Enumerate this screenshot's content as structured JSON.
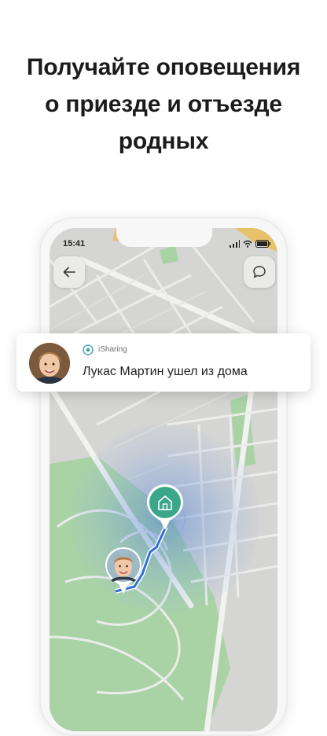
{
  "headline": {
    "line1": "Получайте оповещения",
    "line2": "о приезде и отъезде",
    "line3": "родных"
  },
  "status_bar": {
    "time": "15:41"
  },
  "notification": {
    "app_name": "iSharing",
    "message": "Лукас Мартин ушел из дома"
  },
  "icons": {
    "back": "arrow-left-icon",
    "chat": "chat-bubble-icon",
    "home": "home-icon",
    "app": "isharing-logo-icon"
  },
  "colors": {
    "map_background": "#d5d5d3",
    "park": "#9fcf9d",
    "route": "#2f6fd6",
    "pin": "#3aa68a",
    "geofence": "#5b8bd8"
  }
}
